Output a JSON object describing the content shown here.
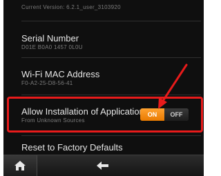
{
  "settings": {
    "version": {
      "value": "Current Version: 6.2.1_user_3103920"
    },
    "serial": {
      "title": "Serial Number",
      "value": "D01E B0A0 1457 0L0U"
    },
    "wifi_mac": {
      "title": "Wi-Fi MAC Address",
      "value": "F0-A2-25-D8-56-41"
    },
    "install_apps": {
      "title": "Allow Installation of Applications",
      "subtitle": "From Unknown Sources",
      "toggle_on": "ON",
      "toggle_off": "OFF",
      "state": "on"
    },
    "reset": {
      "title": "Reset to Factory Defaults"
    }
  },
  "navbar": {
    "home_icon": "home-icon",
    "back_icon": "back-arrow-icon"
  },
  "annotation": {
    "color": "#e81b1b",
    "toggle_accent": "#f08a10"
  }
}
